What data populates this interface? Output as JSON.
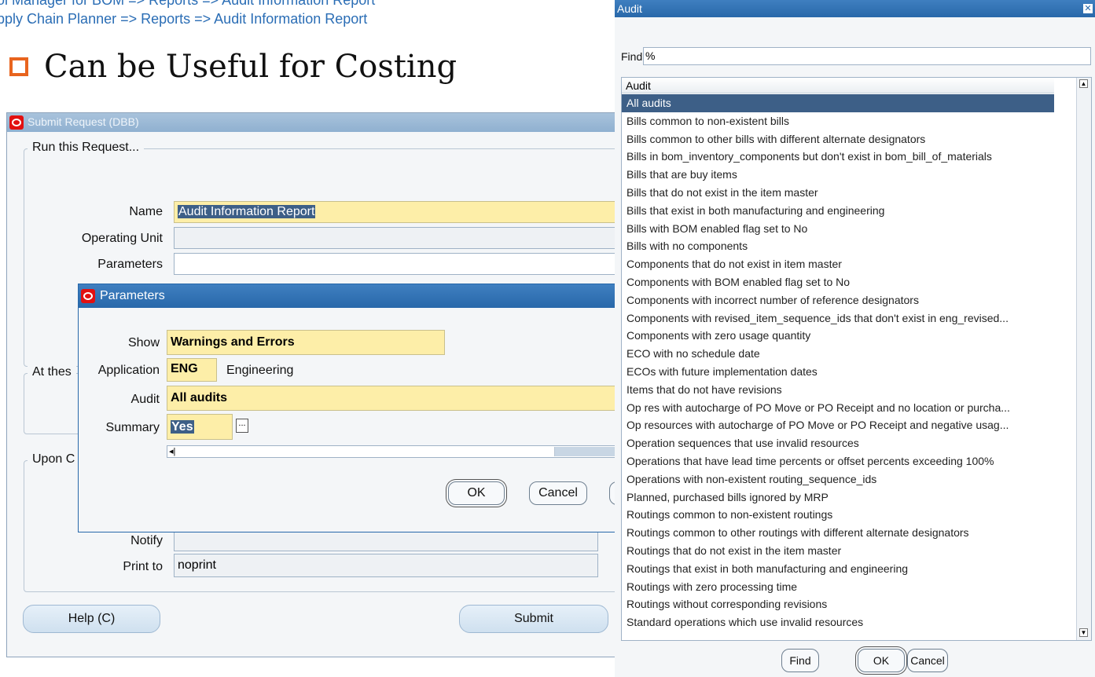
{
  "slide": {
    "nav_line1": "ol Manager for BOM => Reports => Audit Information Report",
    "nav_line2": "pply Chain Planner => Reports  => Audit Information Report",
    "heading": "Can be Useful for Costing"
  },
  "submit_request": {
    "title": "Submit Request (DBB)",
    "run_group_label": "Run this Request...",
    "name_label": "Name",
    "name_value": "Audit Information Report",
    "operating_unit_label": "Operating Unit",
    "operating_unit_value": "",
    "parameters_label": "Parameters",
    "parameters_value": "",
    "at_these_label": "At thes",
    "upon_label": "Upon C",
    "notify_label": "Notify",
    "notify_value": "",
    "print_to_label": "Print to",
    "print_to_value": "noprint",
    "help_button": "Help (C)",
    "submit_button": "Submit"
  },
  "parameters_dialog": {
    "title": "Parameters",
    "show_label": "Show",
    "show_value": "Warnings and Errors",
    "application_label": "Application",
    "application_code": "ENG",
    "application_name": "Engineering",
    "audit_label": "Audit",
    "audit_value": "All audits",
    "summary_label": "Summary",
    "summary_value": "Yes",
    "lov_button": "...",
    "ok_button": "OK",
    "cancel_button": "Cancel"
  },
  "audit_lov": {
    "title": "Audit",
    "close_icon": "close-icon",
    "find_label": "Find",
    "find_value": "%",
    "column_header": "Audit",
    "items": [
      "All audits",
      "Bills common to non-existent bills",
      "Bills common to other bills with different alternate designators",
      "Bills in bom_inventory_components but don't exist in bom_bill_of_materials",
      "Bills that are buy items",
      "Bills that do not exist in the item master",
      "Bills that exist in both manufacturing and engineering",
      "Bills with BOM enabled flag set to No",
      "Bills with no components",
      "Components that do not exist in item master",
      "Components with BOM enabled flag set to No",
      "Components with incorrect number of reference designators",
      "Components with revised_item_sequence_ids that don't exist in eng_revised...",
      "Components with zero usage quantity",
      "ECO with no schedule date",
      "ECOs with future implementation dates",
      "Items that do not have revisions",
      "Op res with autocharge of PO Move or PO Receipt and no location or purcha...",
      "Op resources with autocharge of PO Move or PO Receipt and negative usag...",
      "Operation sequences that use invalid resources",
      "Operations that have lead time percents or offset percents exceeding 100%",
      "Operations with non-existent routing_sequence_ids",
      "Planned, purchased bills ignored by MRP",
      "Routings common to non-existent routings",
      "Routings common to other routings with different alternate designators",
      "Routings that do not exist in the item master",
      "Routings that exist in both manufacturing and engineering",
      "Routings with zero processing time",
      "Routings without corresponding revisions",
      "Standard operations which use invalid resources"
    ],
    "find_button": "Find",
    "ok_button": "OK",
    "cancel_button": "Cancel"
  },
  "colors": {
    "accent_orange": "#e8641e",
    "nav_blue": "#2a6db5",
    "required_yellow": "#fdeea8",
    "selection_blue": "#3d5f87",
    "titlebar_blue": "#2868aa"
  }
}
